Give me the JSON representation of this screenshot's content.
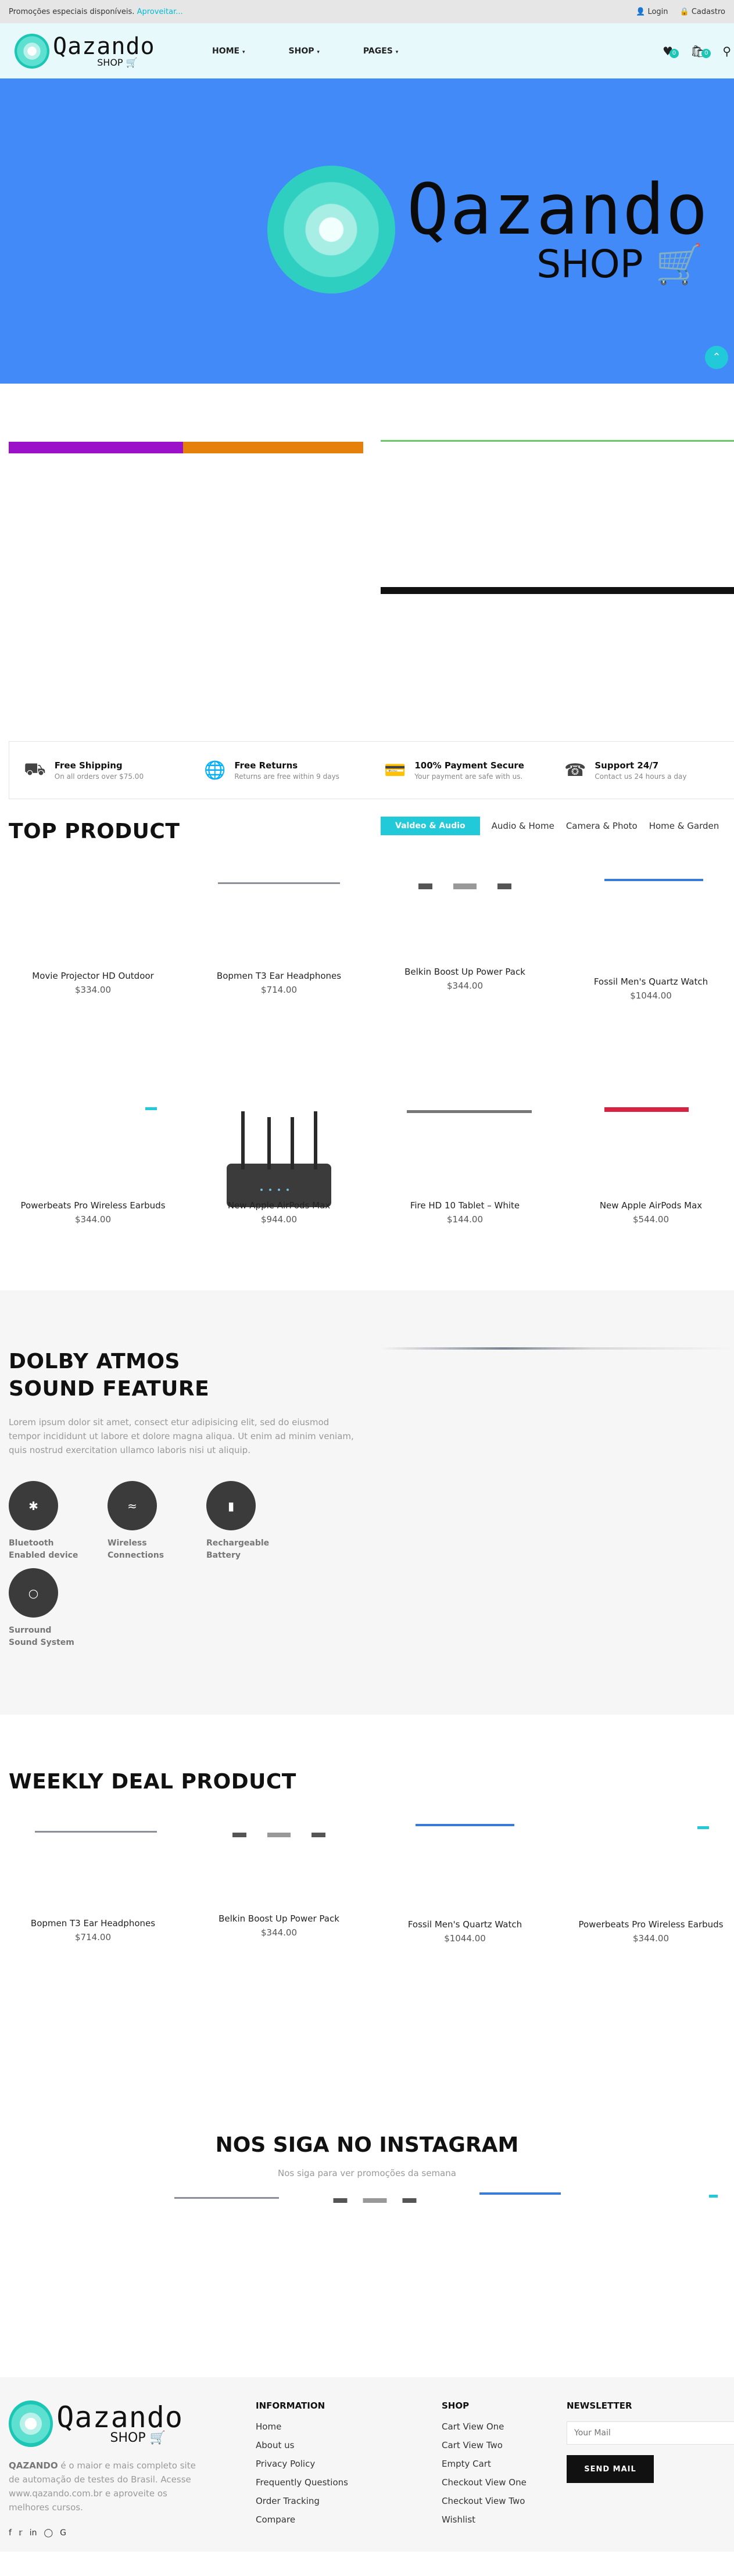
{
  "topbar": {
    "promo_text": "Promoções especiais disponíveis.",
    "promo_link": "Aproveitar...",
    "login": "Login",
    "register": "Cadastro"
  },
  "header": {
    "logo_word": "Qazando",
    "logo_shop": "SHOP",
    "nav": [
      "HOME",
      "SHOP",
      "PAGES"
    ],
    "wishlist_count": "0",
    "cart_count": "0"
  },
  "hero": {
    "logo_word": "Qazando",
    "logo_shop": "SHOP"
  },
  "services": [
    {
      "title": "Free Shipping",
      "sub": "On all orders over $75.00"
    },
    {
      "title": "Free Returns",
      "sub": "Returns are free within 9 days"
    },
    {
      "title": "100% Payment Secure",
      "sub": "Your payment are safe with us."
    },
    {
      "title": "Support 24/7",
      "sub": "Contact us 24 hours a day"
    }
  ],
  "top_product": {
    "title": "TOP PRODUCT",
    "tabs": [
      "Valdeo & Audio",
      "Audio & Home",
      "Camera & Photo",
      "Home & Garden"
    ],
    "items": [
      {
        "name": "Movie Projector HD Outdoor",
        "price": "$334.00"
      },
      {
        "name": "Bopmen T3 Ear Headphones",
        "price": "$714.00"
      },
      {
        "name": "Belkin Boost Up Power Pack",
        "price": "$344.00"
      },
      {
        "name": "Fossil Men's Quartz Watch",
        "price": "$1044.00"
      },
      {
        "name": "Powerbeats Pro Wireless Earbuds",
        "price": "$344.00"
      },
      {
        "name": "New Apple AirPods Max",
        "price": "$944.00"
      },
      {
        "name": "Fire HD 10 Tablet – White",
        "price": "$144.00"
      },
      {
        "name": "New Apple AirPods Max",
        "price": "$544.00"
      }
    ]
  },
  "dolby": {
    "title_line1": "DOLBY ATMOS",
    "title_line2": "SOUND FEATURE",
    "description": "Lorem ipsum dolor sit amet, consect etur adipisicing elit, sed do eiusmod tempor incididunt ut labore et dolore magna aliqua. Ut enim ad minim veniam, quis nostrud exercitation ullamco laboris nisi ut aliquip.",
    "features": [
      {
        "line1": "Bluetooth",
        "line2": "Enabled device",
        "icon": "bluetooth-icon"
      },
      {
        "line1": "Wireless",
        "line2": "Connections",
        "icon": "wifi-icon"
      },
      {
        "line1": "Rechargeable",
        "line2": "Battery",
        "icon": "battery-icon"
      },
      {
        "line1": "Surround",
        "line2": "Sound System",
        "icon": "speaker-icon"
      }
    ]
  },
  "weekly": {
    "title": "WEEKLY DEAL PRODUCT",
    "items": [
      {
        "name": "Bopmen T3 Ear Headphones",
        "price": "$714.00"
      },
      {
        "name": "Belkin Boost Up Power Pack",
        "price": "$344.00"
      },
      {
        "name": "Fossil Men's Quartz Watch",
        "price": "$1044.00"
      },
      {
        "name": "Powerbeats Pro Wireless Earbuds",
        "price": "$344.00"
      }
    ]
  },
  "instagram": {
    "title": "NOS SIGA NO INSTAGRAM",
    "subtitle": "Nos siga para ver promoções da semana"
  },
  "footer": {
    "logo_word": "Qazando",
    "logo_shop": "SHOP",
    "about_brand": "QAZANDO",
    "about_text": " é o maior e mais completo site de automação de testes do Brasil. Acesse www.qazando.com.br e aproveite os melhores cursos.",
    "information_title": "INFORMATION",
    "information_links": [
      "Home",
      "About us",
      "Privacy Policy",
      "Frequently Questions",
      "Order Tracking",
      "Compare"
    ],
    "shop_title": "SHOP",
    "shop_links": [
      "Cart View One",
      "Cart View Two",
      "Empty Cart",
      "Checkout View One",
      "Checkout View Two",
      "Wishlist"
    ],
    "newsletter_title": "NEWSLETTER",
    "newsletter_placeholder": "Your Mail",
    "newsletter_button": "SEND MAIL"
  }
}
